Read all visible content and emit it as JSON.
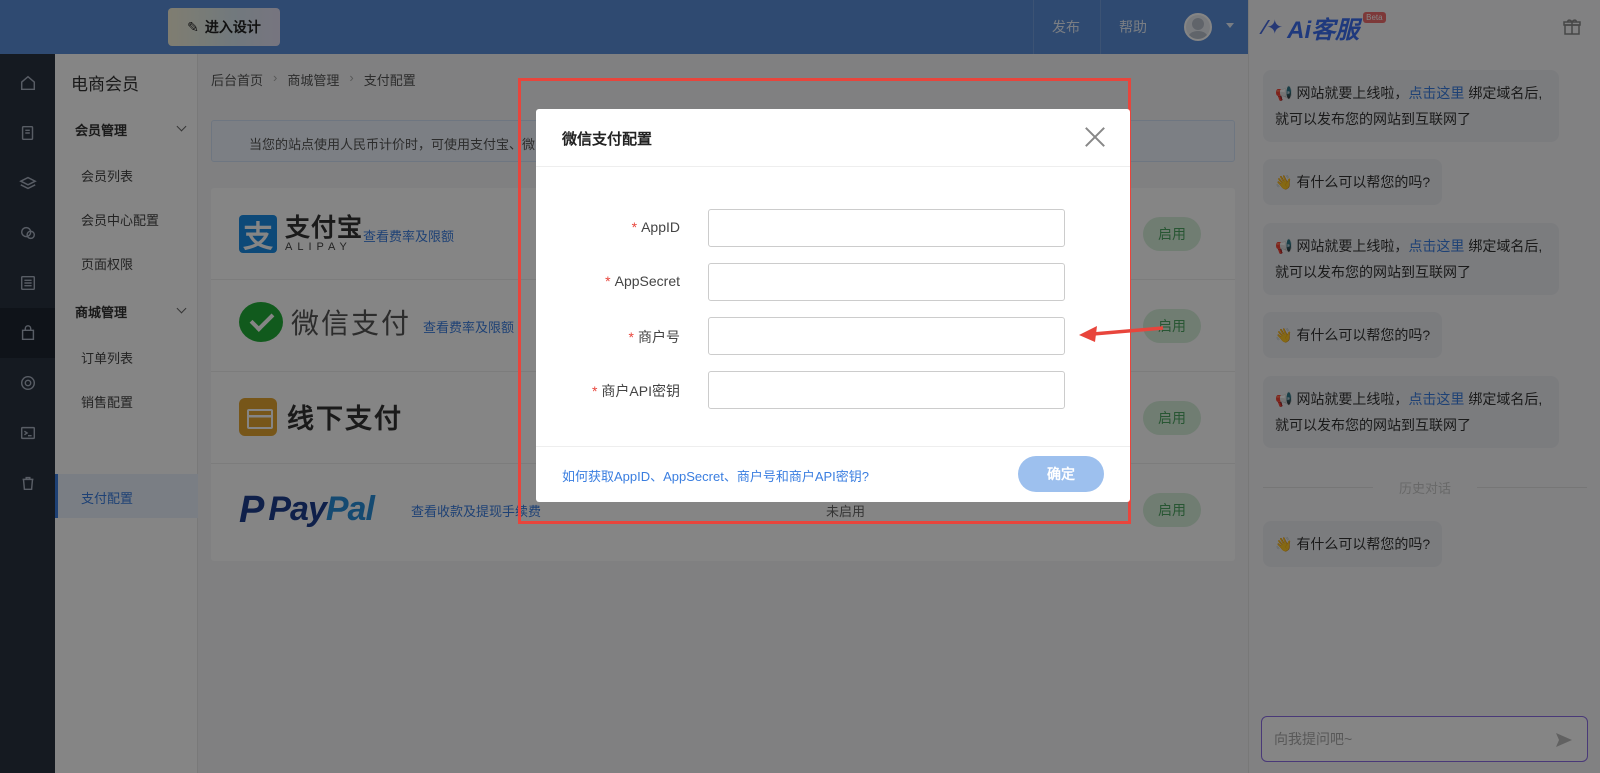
{
  "topbar": {
    "design_button": "进入设计",
    "publish": "发布",
    "help": "帮助"
  },
  "rail": [
    "home-icon",
    "pages-icon",
    "layers-icon",
    "chat-icon",
    "list-icon",
    "shop-icon",
    "gear-icon",
    "terminal-icon",
    "trash-icon"
  ],
  "subnav": {
    "title": "电商会员",
    "groups": [
      {
        "label": "会员管理",
        "items": [
          "会员列表",
          "会员中心配置",
          "页面权限"
        ]
      },
      {
        "label": "商城管理",
        "items": [
          "订单列表",
          "销售配置",
          "支付配置"
        ]
      }
    ],
    "active": "支付配置"
  },
  "breadcrumb": [
    "后台首页",
    "商城管理",
    "支付配置"
  ],
  "notice": "当您的站点使用人民币计价时，可使用支付宝、微",
  "payments": [
    {
      "logo": "alipay",
      "cn": "支付宝",
      "en": "ALIPAY",
      "link": "查看费率及限额",
      "status": "",
      "button": "启用"
    },
    {
      "logo": "wechat",
      "cn": "微信支付",
      "link": "查看费率及限额",
      "status": "",
      "button": "启用"
    },
    {
      "logo": "offline",
      "cn": "线下支付",
      "link": "",
      "status": "",
      "button": "启用"
    },
    {
      "logo": "paypal",
      "cn": "PayPal",
      "link": "查看收款及提现手续费",
      "status": "未启用",
      "button": "启用"
    }
  ],
  "ai": {
    "title": "Ai客服",
    "beta": "Beta",
    "messages": [
      {
        "type": "notice",
        "pre": "网站就要上线啦，",
        "link": "点击这里",
        "post": "绑定域名后,就可以发布您的网站到互联网了"
      },
      {
        "type": "help",
        "text": "有什么可以帮您的吗?"
      },
      {
        "type": "notice",
        "pre": "网站就要上线啦，",
        "link": "点击这里",
        "post": "绑定域名后,就可以发布您的网站到互联网了"
      },
      {
        "type": "help",
        "text": "有什么可以帮您的吗?"
      },
      {
        "type": "notice",
        "pre": "网站就要上线啦，",
        "link": "点击这里",
        "post": "绑定域名后,就可以发布您的网站到互联网了"
      }
    ],
    "history": "历史对话",
    "last_message": "有什么可以帮您的吗?",
    "input_placeholder": "向我提问吧~"
  },
  "modal": {
    "title": "微信支付配置",
    "fields": [
      {
        "label": "AppID",
        "value": ""
      },
      {
        "label": "AppSecret",
        "value": ""
      },
      {
        "label": "商户号",
        "value": ""
      },
      {
        "label": "商户API密钥",
        "value": ""
      }
    ],
    "help_link": "如何获取AppID、AppSecret、商户号和商户API密钥?",
    "confirm": "确定"
  },
  "colors": {
    "accent": "#3a7ee0",
    "topbar": "#5b8fd9",
    "highlight": "#e8453c",
    "enable": "#4ea562"
  }
}
